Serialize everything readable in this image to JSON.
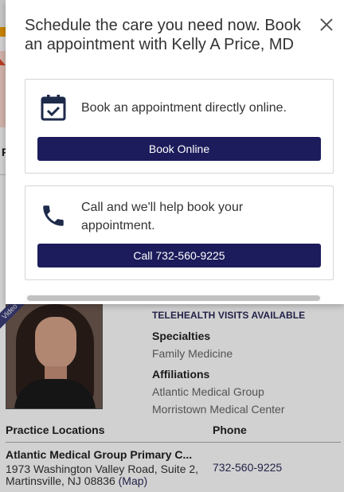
{
  "modal": {
    "title": "Schedule the care you need now. Book an appointment with Kelly A Price, MD",
    "close_icon": "close-icon",
    "online_card": {
      "icon": "calendar-check-icon",
      "text": "Book an appointment directly online.",
      "button_label": "Book Online"
    },
    "phone_card": {
      "icon": "phone-icon",
      "text": "Call and we'll help book your appointment.",
      "button_label": "Call 732-560-9225"
    }
  },
  "profile": {
    "video_badge": "Video",
    "telehealth": "TELEHEALTH VISITS AVAILABLE",
    "specialties_label": "Specialties",
    "specialties": [
      "Family Medicine"
    ],
    "affiliations_label": "Affiliations",
    "affiliations": [
      "Atlantic Medical Group",
      "Morristown Medical Center"
    ]
  },
  "locations": {
    "header_location": "Practice Locations",
    "header_phone": "Phone",
    "items": [
      {
        "name": "Atlantic Medical Group Primary C...",
        "address_line1": "1973 Washington Valley Road, Suite 2,",
        "address_line2": "Martinsville, NJ 08836",
        "map_label": "(Map)",
        "phone": "732-560-9225"
      }
    ]
  },
  "background_letter": "P",
  "colors": {
    "primary_button": "#1c1c5c",
    "accent_orange": "#f6a000",
    "link": "#2a2a5a"
  }
}
